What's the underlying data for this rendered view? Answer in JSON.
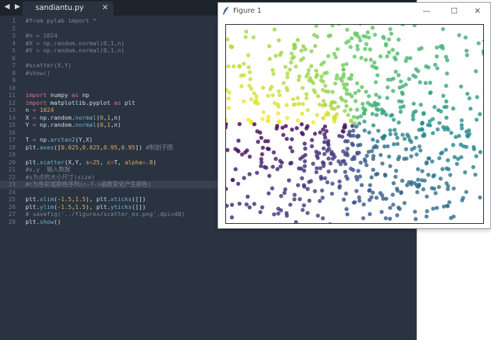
{
  "editor": {
    "nav": "◀ ▶",
    "tab": {
      "title": "sandiantu.py",
      "close": "✕"
    },
    "highlight_line": 23,
    "lines": [
      [
        [
          "c",
          "#from pylab import *"
        ]
      ],
      [],
      [
        [
          "c",
          "#n = 1024"
        ]
      ],
      [
        [
          "c",
          "#X = np.random.normal(0,1,n)"
        ]
      ],
      [
        [
          "c",
          "#Y = np.random.normal(0,1,n)"
        ]
      ],
      [],
      [
        [
          "c",
          "#scatter(X,Y)"
        ]
      ],
      [
        [
          "c",
          "#show()"
        ]
      ],
      [],
      [],
      [
        [
          "k",
          "import"
        ],
        [
          "t",
          " numpy "
        ],
        [
          "k",
          "as"
        ],
        [
          "t",
          " np"
        ]
      ],
      [
        [
          "k",
          "import"
        ],
        [
          "t",
          " matplotlib.pyplot "
        ],
        [
          "k",
          "as"
        ],
        [
          "t",
          " plt"
        ]
      ],
      [
        [
          "t",
          "n "
        ],
        [
          "k",
          "="
        ],
        [
          "t",
          " "
        ],
        [
          "n",
          "1024"
        ]
      ],
      [
        [
          "t",
          "X "
        ],
        [
          "k",
          "="
        ],
        [
          "t",
          " np.random."
        ],
        [
          "f",
          "normal"
        ],
        [
          "t",
          "("
        ],
        [
          "n",
          "0"
        ],
        [
          "t",
          ","
        ],
        [
          "n",
          "1"
        ],
        [
          "t",
          ",n)"
        ]
      ],
      [
        [
          "t",
          "Y "
        ],
        [
          "k",
          "="
        ],
        [
          "t",
          " np.random."
        ],
        [
          "f",
          "normal"
        ],
        [
          "t",
          "("
        ],
        [
          "n",
          "0"
        ],
        [
          "t",
          ","
        ],
        [
          "n",
          "1"
        ],
        [
          "t",
          ",n)"
        ]
      ],
      [],
      [
        [
          "t",
          "T "
        ],
        [
          "k",
          "="
        ],
        [
          "t",
          " np."
        ],
        [
          "f",
          "arctan2"
        ],
        [
          "t",
          "(Y,X)"
        ]
      ],
      [
        [
          "t",
          "plt."
        ],
        [
          "f",
          "axes"
        ],
        [
          "t",
          "(["
        ],
        [
          "n",
          "0.025"
        ],
        [
          "t",
          ","
        ],
        [
          "n",
          "0.025"
        ],
        [
          "t",
          ","
        ],
        [
          "n",
          "0.95"
        ],
        [
          "t",
          ","
        ],
        [
          "n",
          "0.95"
        ],
        [
          "t",
          "]) "
        ],
        [
          "c",
          "#制划子图"
        ]
      ],
      [],
      [
        [
          "t",
          "plt."
        ],
        [
          "f",
          "scatter"
        ],
        [
          "t",
          "(X,Y, "
        ],
        [
          "n",
          "s"
        ],
        [
          "k",
          "="
        ],
        [
          "n",
          "25"
        ],
        [
          "t",
          ", "
        ],
        [
          "n",
          "c"
        ],
        [
          "k",
          "="
        ],
        [
          "t",
          "T, "
        ],
        [
          "n",
          "alpha"
        ],
        [
          "k",
          "="
        ],
        [
          "n",
          ".8"
        ],
        [
          "t",
          ")"
        ]
      ],
      [
        [
          "c",
          "#x,y  输入数据"
        ]
      ],
      [
        [
          "c",
          "#s为点的大小尺寸(size)"
        ]
      ],
      [
        [
          "c",
          "#c为色彩或颜色序列(c~T->函数变化产生颜色)"
        ]
      ],
      [],
      [
        [
          "t",
          "plt."
        ],
        [
          "f",
          "xlim"
        ],
        [
          "t",
          "(-"
        ],
        [
          "n",
          "1.5"
        ],
        [
          "t",
          ","
        ],
        [
          "n",
          "1.5"
        ],
        [
          "t",
          "), plt."
        ],
        [
          "f",
          "xticks"
        ],
        [
          "t",
          "([])"
        ]
      ],
      [
        [
          "t",
          "plt."
        ],
        [
          "f",
          "ylim"
        ],
        [
          "t",
          "(-"
        ],
        [
          "n",
          "1.5"
        ],
        [
          "t",
          ","
        ],
        [
          "n",
          "1.5"
        ],
        [
          "t",
          "), plt."
        ],
        [
          "f",
          "yticks"
        ],
        [
          "t",
          "([])"
        ]
      ],
      [
        [
          "c",
          "# savefig('../figures/scatter_ex.png',dpi=48)"
        ]
      ],
      [
        [
          "t",
          "plt."
        ],
        [
          "f",
          "show"
        ],
        [
          "t",
          "()"
        ]
      ]
    ]
  },
  "figure": {
    "title": "Figure 1",
    "buttons": {
      "minimize": "—",
      "maximize": "☐",
      "close": "✕"
    }
  },
  "chart_data": {
    "type": "scatter",
    "n": 1024,
    "xlim": [
      -1.5,
      1.5
    ],
    "ylim": [
      -1.5,
      1.5
    ],
    "xticks": [],
    "yticks": [],
    "color_by": "arctan2(Y,X)",
    "colormap": [
      "#440154",
      "#3b528b",
      "#21918c",
      "#5ec962",
      "#fde725"
    ],
    "point_size": 25,
    "alpha": 0.8,
    "distribution": "normal(0,1) on X and Y"
  }
}
